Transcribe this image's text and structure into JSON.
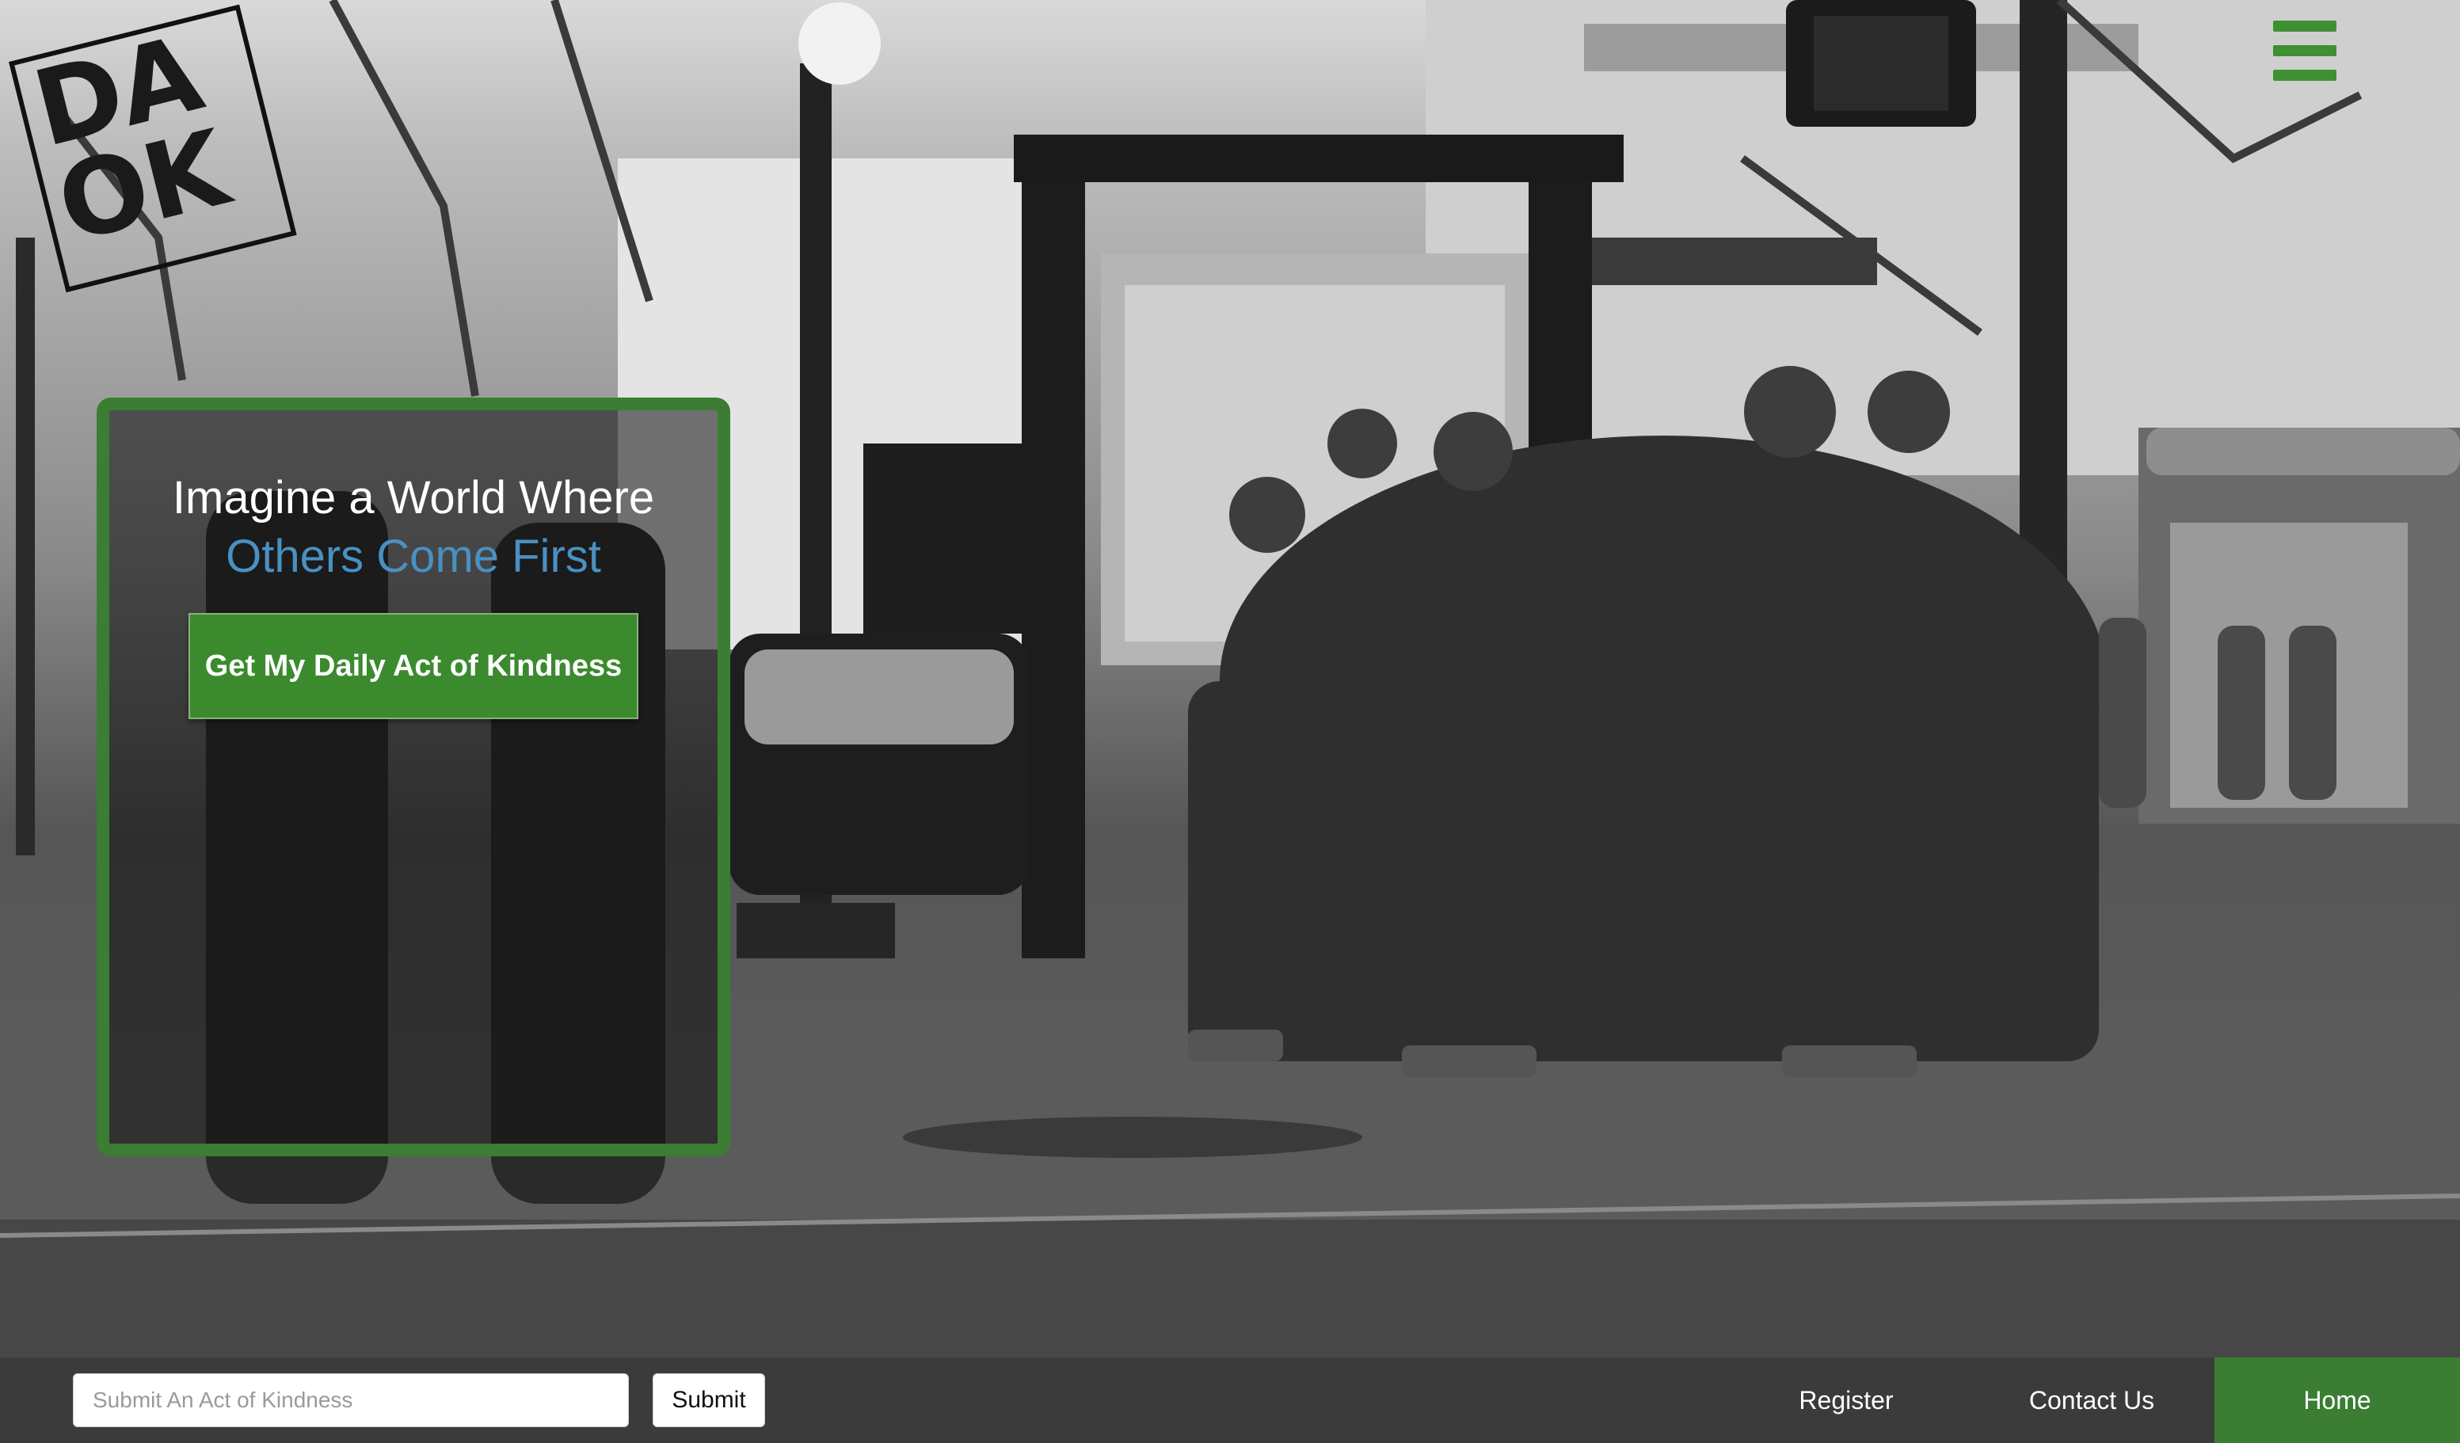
{
  "logo": {
    "text": "DA\nOK"
  },
  "hero": {
    "title_line_1": "Imagine a World Where",
    "title_line_2": "Others Come First",
    "cta_label": "Get My Daily Act of Kindness"
  },
  "bottom_bar": {
    "kindness_input": {
      "value": "",
      "placeholder": "Submit An Act of Kindness"
    },
    "submit_label": "Submit"
  },
  "nav": {
    "items": [
      {
        "label": "Register"
      },
      {
        "label": "Contact Us"
      },
      {
        "label": "Home",
        "active": true
      }
    ]
  },
  "icons": {
    "menu": "hamburger-menu-icon"
  },
  "colors": {
    "accent_green": "#3b7d32",
    "title_blue": "#4a90c2",
    "bottom_bar": "#3b3b3b"
  }
}
